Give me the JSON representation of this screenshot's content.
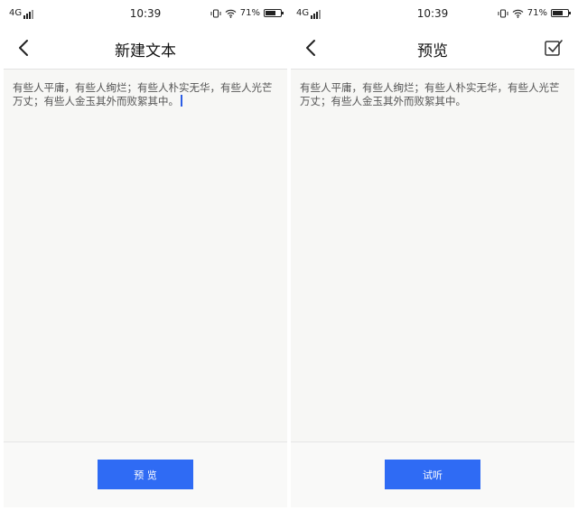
{
  "status_bar": {
    "network": "4G",
    "time": "10:39",
    "battery": "71%",
    "battery_level": 0.71
  },
  "editor_screen": {
    "title": "新建文本",
    "text": "有些人平庸，有些人绚烂；有些人朴实无华，有些人光芒万丈；有些人金玉其外而败絮其中。",
    "button_label": "预 览"
  },
  "preview_screen": {
    "title": "预览",
    "text": "有些人平庸，有些人绚烂；有些人朴实无华，有些人光芒万丈；有些人金玉其外而败絮其中。",
    "button_label": "试听"
  },
  "icons": {
    "back": "chevron-left-icon",
    "confirm": "checkbox-confirm-icon",
    "signal": "signal-bars-icon",
    "vibrate": "vibrate-icon",
    "wifi": "wifi-icon",
    "battery": "battery-icon"
  },
  "colors": {
    "accent": "#2f6bf4",
    "caret": "#2c5de5",
    "background": "#f7f7f5"
  }
}
